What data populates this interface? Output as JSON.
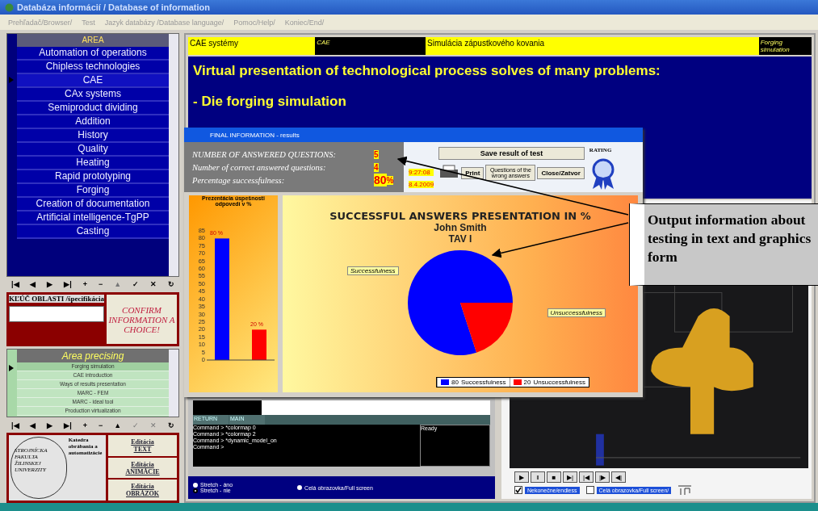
{
  "window": {
    "title": "Databáza informácií / Database of information"
  },
  "menu": [
    "Prehľadač/Browser/",
    "Test",
    "Jazyk databázy /Database language/",
    "Pomoc/Help/",
    "Koniec/End/"
  ],
  "area": {
    "header": "AREA",
    "items": [
      {
        "label": "Automation of operations",
        "selected": false
      },
      {
        "label": "Chipless technologies",
        "selected": false
      },
      {
        "label": "CAE",
        "selected": true
      },
      {
        "label": "CAx systems",
        "selected": false
      },
      {
        "label": "Semiproduct dividing",
        "selected": false
      },
      {
        "label": "Addition",
        "selected": false
      },
      {
        "label": "History",
        "selected": false
      },
      {
        "label": "Quality",
        "selected": false
      },
      {
        "label": "Heating",
        "selected": false
      },
      {
        "label": "Rapid prototyping",
        "selected": false
      },
      {
        "label": "Forging",
        "selected": false
      },
      {
        "label": "Creation of documentation",
        "selected": false
      },
      {
        "label": "Artificial intelligence-TgPP",
        "selected": false
      },
      {
        "label": "Casting",
        "selected": false
      }
    ]
  },
  "nav_top": [
    {
      "label": "|◀",
      "disabled": false
    },
    {
      "label": "◀",
      "disabled": false
    },
    {
      "label": "▶",
      "disabled": false
    },
    {
      "label": "▶|",
      "disabled": false
    },
    {
      "label": "+",
      "disabled": false
    },
    {
      "label": "−",
      "disabled": false
    },
    {
      "label": "▲",
      "disabled": true
    },
    {
      "label": "✓",
      "disabled": false
    },
    {
      "label": "✕",
      "disabled": false
    },
    {
      "label": "↻",
      "disabled": false
    }
  ],
  "key": {
    "label": "KĽÚČ OBLASTI /špecifikácia",
    "confirm": "CONFIRM INFORMATION A CHOICE!"
  },
  "precising": {
    "header": "Area precising",
    "items": [
      {
        "label": "Forging simulation",
        "selected": true
      },
      {
        "label": "CAE introduction",
        "selected": false
      },
      {
        "label": "Ways of results presentation",
        "selected": false
      },
      {
        "label": "MARC - FEM",
        "selected": false
      },
      {
        "label": "MARC - ideal tool",
        "selected": false
      },
      {
        "label": "Production virtualization",
        "selected": false
      }
    ]
  },
  "nav_bottom": [
    {
      "label": "|◀",
      "disabled": false
    },
    {
      "label": "◀",
      "disabled": false
    },
    {
      "label": "▶",
      "disabled": false
    },
    {
      "label": "▶|",
      "disabled": false
    },
    {
      "label": "+",
      "disabled": false
    },
    {
      "label": "−",
      "disabled": false
    },
    {
      "label": "▲",
      "disabled": false
    },
    {
      "label": "✓",
      "disabled": true
    },
    {
      "label": "✕",
      "disabled": true
    },
    {
      "label": "↻",
      "disabled": false
    }
  ],
  "logo": {
    "department": "Katedra obrábania a automatizácie",
    "faculty": "STROJNÍCKA FAKULTA ŽILINSKEJ UNIVERZITY"
  },
  "edit_buttons": [
    [
      "Editácia",
      "TEXT"
    ],
    [
      "Editácia",
      "ANIMÁCIE"
    ],
    [
      "Editácia",
      "OBRÁZOK"
    ]
  ],
  "header_cells": [
    {
      "text": "CAE systémy",
      "kind": "plain"
    },
    {
      "text": "CAE",
      "kind": "dark"
    },
    {
      "text": "Simulácia zápustkového kovania",
      "kind": "plain"
    },
    {
      "text": "Forging simulation",
      "kind": "dark"
    }
  ],
  "presentation": {
    "heading": "Virtual presentation of  technological process solves of many problems:",
    "bullet": "- Die forging simulation"
  },
  "viewer_left": {
    "menu": [
      "RETURN",
      "MAIN"
    ],
    "console": [
      "Command > *colormap 0",
      "Command > *colormap 2",
      "Command > *dynamic_model_on",
      "Command >"
    ],
    "status": "Ready"
  },
  "options": [
    {
      "label": "Stretch - áno",
      "selected": false
    },
    {
      "label": "Stretch - nie",
      "selected": true
    }
  ],
  "full_screen_option": {
    "label": "Celá obrazovka/Full screen",
    "selected": false
  },
  "player": {
    "buttons": [
      "▶",
      "‖",
      "■",
      "▶|",
      "|◀",
      "|▶",
      "◀|"
    ],
    "checks": [
      {
        "label": "Nekonečne/endless",
        "checked": true
      },
      {
        "label": "Celá obrazovka/Full screen/",
        "checked": false
      }
    ]
  },
  "dialog": {
    "title": "FINAL INFORMATION - results",
    "stats": [
      {
        "label": "NUMBER OF ANSWERED QUESTIONS:",
        "value": "5"
      },
      {
        "label": "Number of correct answered questions:",
        "value": "4"
      },
      {
        "label": "Percentage successfulness:",
        "value": "80",
        "unit": "%"
      }
    ],
    "time": "9:27:08",
    "date": "8.4.2009",
    "save": "Save result of test",
    "print": "Print",
    "wrong": "Questions of the wrong answers",
    "close": "Close/Zatvor",
    "rating": "RATING",
    "bar_chart": {
      "chart_data": {
        "type": "bar",
        "title": "Prezentácia úspešnosti odpovedí v %",
        "categories": [
          null,
          null
        ],
        "values": [
          80,
          20
        ],
        "ylim": [
          0,
          85
        ],
        "yticks": [
          0,
          5,
          10,
          15,
          20,
          25,
          30,
          35,
          40,
          45,
          50,
          55,
          60,
          65,
          70,
          75,
          80,
          85
        ],
        "value_labels": [
          "80 %",
          "20 %"
        ]
      }
    },
    "pie_chart": {
      "chart_data": {
        "type": "pie",
        "title": "SUCCESSFUL ANSWERS PRESENTATION IN %",
        "categories": [
          "Successfulness",
          "Unsuccessfulness"
        ],
        "values": [
          80,
          20
        ],
        "data_labels": true,
        "legend": "bottom"
      },
      "subtitles": [
        "John Smith",
        "TAV I"
      ]
    }
  },
  "callout": {
    "text": "Output information about testing in text and graphics form"
  }
}
